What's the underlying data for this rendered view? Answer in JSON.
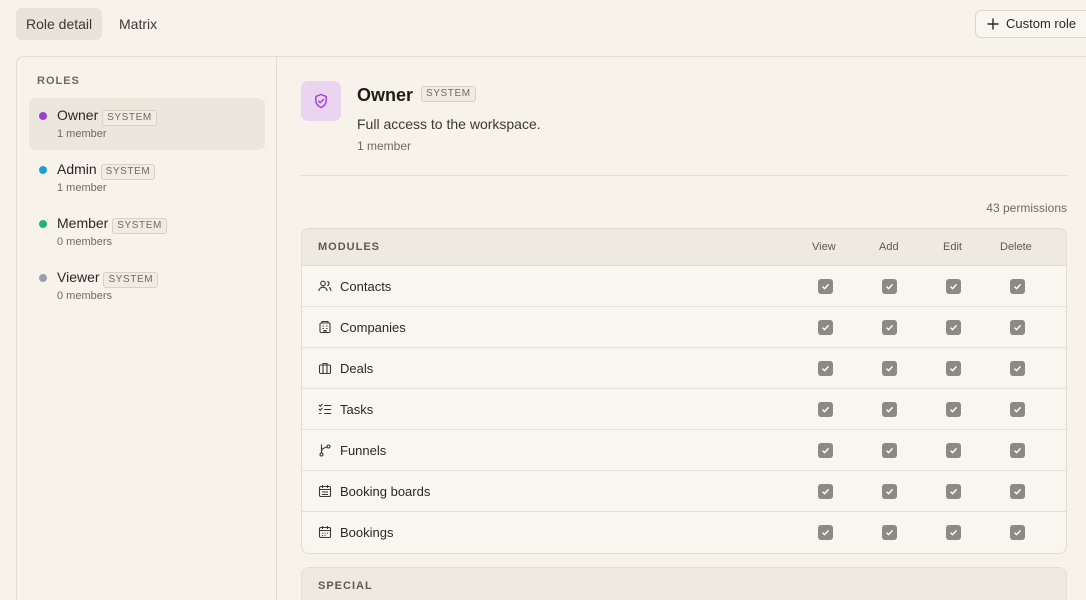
{
  "tabs": [
    {
      "label": "Role detail",
      "active": true
    },
    {
      "label": "Matrix",
      "active": false
    }
  ],
  "custom_role_button": "Custom role",
  "sidebar": {
    "heading": "ROLES",
    "roles": [
      {
        "name": "Owner",
        "badge": "SYSTEM",
        "count": "1 member",
        "color": "#9b3fd9",
        "selected": true
      },
      {
        "name": "Admin",
        "badge": "SYSTEM",
        "count": "1 member",
        "color": "#1aa0d8",
        "selected": false
      },
      {
        "name": "Member",
        "badge": "SYSTEM",
        "count": "0 members",
        "color": "#1fb37a",
        "selected": false
      },
      {
        "name": "Viewer",
        "badge": "SYSTEM",
        "count": "0 members",
        "color": "#9aa0ab",
        "selected": false
      }
    ]
  },
  "detail": {
    "icon": "shield-check-icon",
    "title": "Owner",
    "badge": "SYSTEM",
    "description": "Full access to the workspace.",
    "member_count": "1 member",
    "permission_count": "43 permissions"
  },
  "table": {
    "section": "MODULES",
    "columns": [
      "View",
      "Add",
      "Edit",
      "Delete"
    ],
    "rows": [
      {
        "label": "Contacts",
        "icon": "users-icon",
        "view": true,
        "add": true,
        "edit": true,
        "delete": true
      },
      {
        "label": "Companies",
        "icon": "building-icon",
        "view": true,
        "add": true,
        "edit": true,
        "delete": true
      },
      {
        "label": "Deals",
        "icon": "briefcase-icon",
        "view": true,
        "add": true,
        "edit": true,
        "delete": true
      },
      {
        "label": "Tasks",
        "icon": "checklist-icon",
        "view": true,
        "add": true,
        "edit": true,
        "delete": true
      },
      {
        "label": "Funnels",
        "icon": "git-branch-icon",
        "view": true,
        "add": true,
        "edit": true,
        "delete": true
      },
      {
        "label": "Booking boards",
        "icon": "calendar-list-icon",
        "view": true,
        "add": true,
        "edit": true,
        "delete": true
      },
      {
        "label": "Bookings",
        "icon": "calendar-icon",
        "view": true,
        "add": true,
        "edit": true,
        "delete": true
      }
    ]
  },
  "special_section": "SPECIAL"
}
